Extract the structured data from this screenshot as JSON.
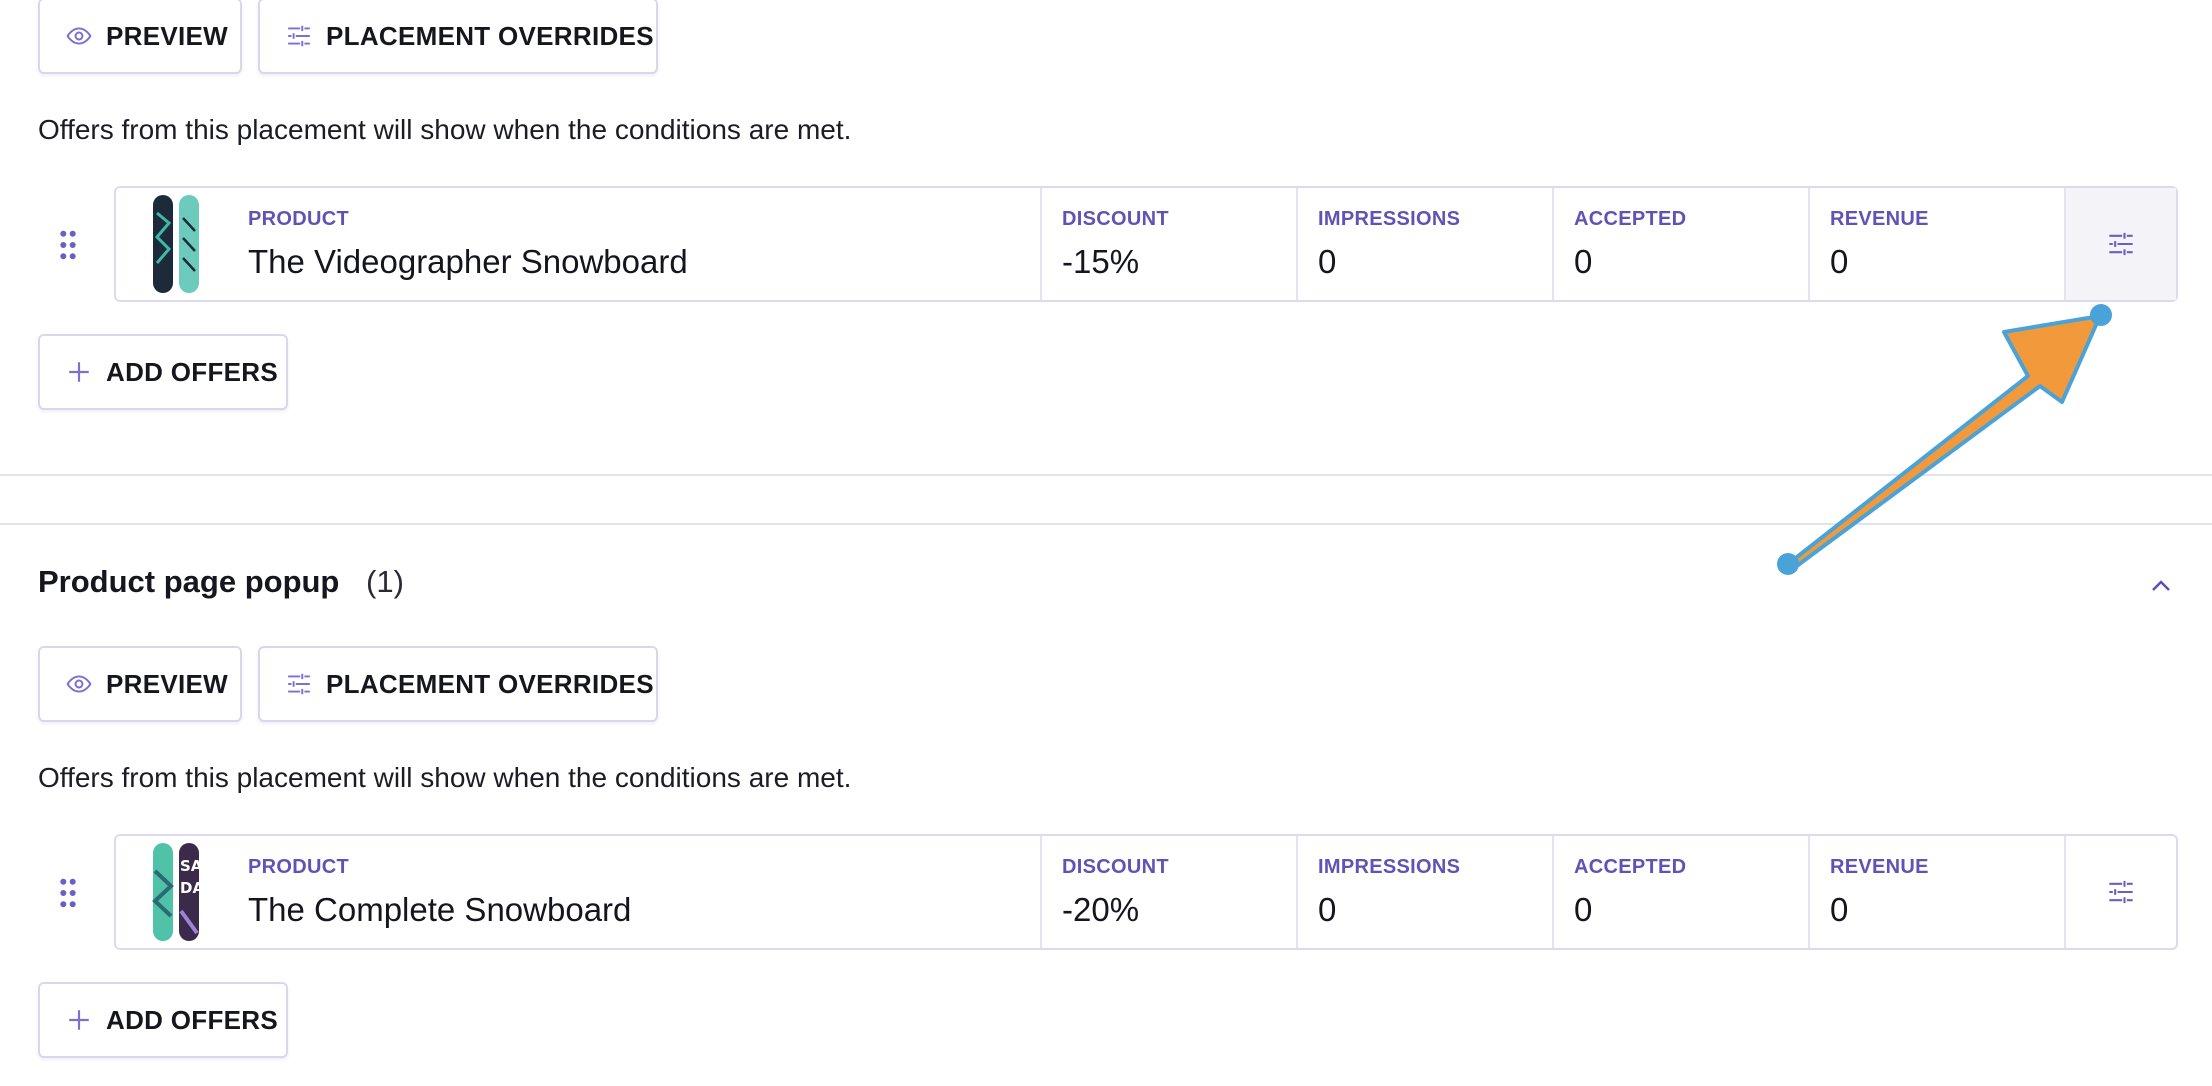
{
  "section1": {
    "preview_label": "PREVIEW",
    "overrides_label": "PLACEMENT OVERRIDES",
    "description": "Offers from this placement will show when the conditions are met.",
    "offer": {
      "product_label": "PRODUCT",
      "product_name": "The Videographer Snowboard",
      "discount_label": "DISCOUNT",
      "discount_value": "-15%",
      "impressions_label": "IMPRESSIONS",
      "impressions_value": "0",
      "accepted_label": "ACCEPTED",
      "accepted_value": "0",
      "revenue_label": "REVENUE",
      "revenue_value": "0"
    },
    "add_offers_label": "ADD OFFERS"
  },
  "section2": {
    "title": "Product page popup",
    "count": "(1)",
    "preview_label": "PREVIEW",
    "overrides_label": "PLACEMENT OVERRIDES",
    "description": "Offers from this placement will show when the conditions are met.",
    "offer": {
      "product_label": "PRODUCT",
      "product_name": "The Complete Snowboard",
      "discount_label": "DISCOUNT",
      "discount_value": "-20%",
      "impressions_label": "IMPRESSIONS",
      "impressions_value": "0",
      "accepted_label": "ACCEPTED",
      "accepted_value": "0",
      "revenue_label": "REVENUE",
      "revenue_value": "0"
    },
    "add_offers_label": "ADD OFFERS"
  },
  "icons": {
    "preview": "eye-icon",
    "overrides": "sliders-icon",
    "add": "plus-icon",
    "drag": "drag-handle-icon",
    "settings": "sliders-icon",
    "collapse": "chevron-up-icon"
  },
  "colors": {
    "accent": "#6153b5",
    "icon": "#7b6fd0",
    "border": "#dcd9f0",
    "annotation_arrow": "#f29a3b",
    "annotation_outline": "#4aa3d8"
  }
}
